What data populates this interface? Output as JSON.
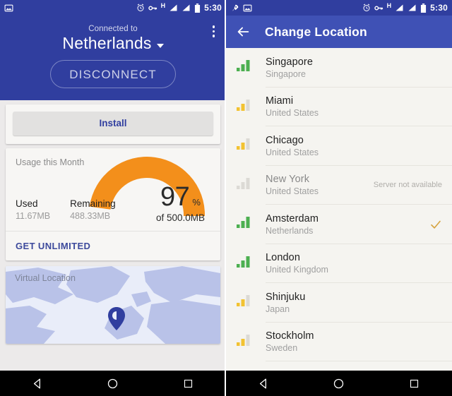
{
  "status_bar": {
    "time": "5:30",
    "left_icons_screen1": [
      "image-icon"
    ],
    "left_icons_screen2": [
      "rocket-icon",
      "image-icon"
    ],
    "right_icons": [
      "alarm-icon",
      "vpn-key-icon",
      "hspa-h-label",
      "signal-icon",
      "signal-sim2-icon",
      "battery-icon"
    ],
    "network_label": "H"
  },
  "screen1": {
    "header": {
      "connected_label": "Connected to",
      "country": "Netherlands",
      "dropdown_icon": "chevron-down-icon",
      "overflow_icon": "overflow-menu-icon",
      "disconnect_label": "DISCONNECT"
    },
    "install_card": {
      "install_label": "Install"
    },
    "usage_card": {
      "title": "Usage this Month",
      "used_label": "Used",
      "used_value": "11.67MB",
      "remaining_label": "Remaining",
      "remaining_value": "488.33MB",
      "percent": "97",
      "percent_sign": "%",
      "of_label": "of 500.0MB",
      "get_unlimited_label": "GET UNLIMITED",
      "gauge_color": "#f38f1b"
    },
    "map_card": {
      "label": "Virtual Location",
      "pin_icon": "map-pin-icon"
    }
  },
  "screen2": {
    "appbar": {
      "back_icon": "back-arrow-icon",
      "title": "Change Location"
    },
    "locations": [
      {
        "city": "Singapore",
        "country": "Singapore",
        "signal": "green",
        "note": "",
        "selected": false
      },
      {
        "city": "Miami",
        "country": "United States",
        "signal": "yellow",
        "note": "",
        "selected": false
      },
      {
        "city": "Chicago",
        "country": "United States",
        "signal": "yellow",
        "note": "",
        "selected": false
      },
      {
        "city": "New York",
        "country": "United States",
        "signal": "gray",
        "note": "Server not available",
        "selected": false
      },
      {
        "city": "Amsterdam",
        "country": "Netherlands",
        "signal": "green",
        "note": "",
        "selected": true
      },
      {
        "city": "London",
        "country": "United Kingdom",
        "signal": "green",
        "note": "",
        "selected": false
      },
      {
        "city": "Shinjuku",
        "country": "Japan",
        "signal": "yellow",
        "note": "",
        "selected": false
      },
      {
        "city": "Stockholm",
        "country": "Sweden",
        "signal": "yellow",
        "note": "",
        "selected": false
      }
    ],
    "check_color": "#d6a441"
  },
  "nav_bar": {
    "back_label": "back-triangle-icon",
    "home_label": "home-circle-icon",
    "recents_label": "recents-square-icon"
  },
  "colors": {
    "status_bar_blue": "#303e9f",
    "appbar_blue": "#3f51b5",
    "accent_orange": "#f38f1b",
    "link_indigo": "#3d4a9c",
    "signal_green": "#4caf50",
    "signal_yellow": "#f2c231",
    "signal_gray": "#c9c7c2"
  }
}
